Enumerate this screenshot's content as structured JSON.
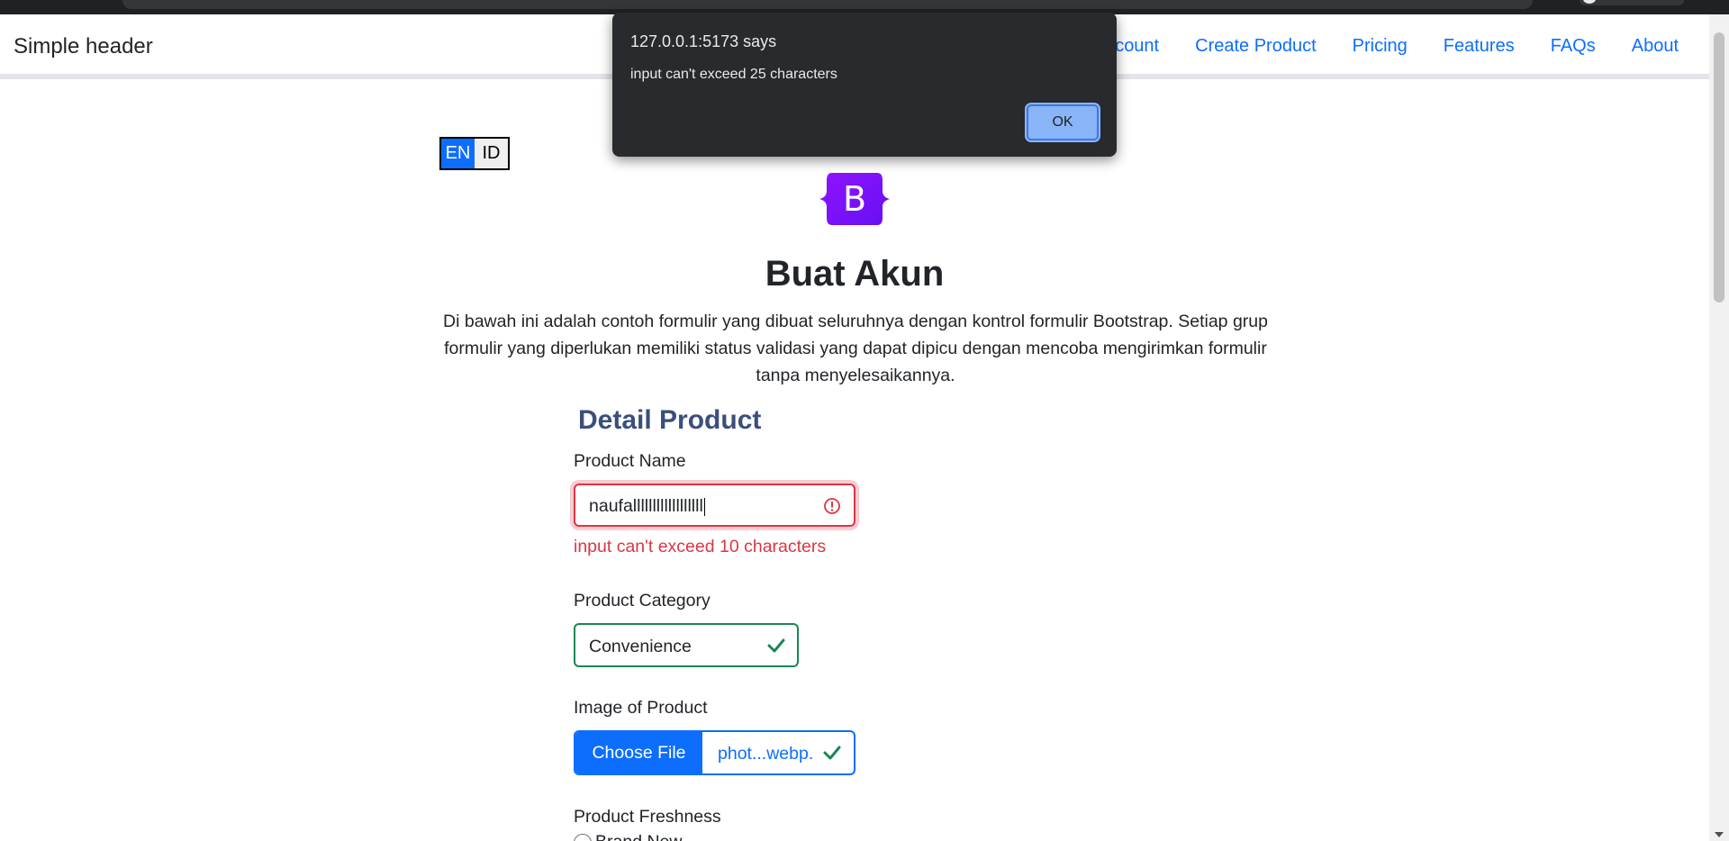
{
  "header": {
    "brand": "Simple header",
    "nav": [
      "ccount",
      "Create Product",
      "Pricing",
      "Features",
      "FAQs",
      "About"
    ]
  },
  "lang_toggle": {
    "active": "EN",
    "inactive": "ID"
  },
  "logo": {
    "letter": "B"
  },
  "page": {
    "title": "Buat Akun",
    "lead": "Di bawah ini adalah contoh formulir yang dibuat seluruhnya dengan kontrol formulir Bootstrap. Setiap grup formulir yang diperlukan memiliki status validasi yang dapat dipicu dengan mencoba mengirimkan formulir tanpa menyelesaikannya."
  },
  "form": {
    "section_title": "Detail Product",
    "product_name": {
      "label": "Product Name",
      "value": "naufallllllllllllllllll",
      "error": "input can't exceed 10 characters"
    },
    "product_category": {
      "label": "Product Category",
      "value": "Convenience"
    },
    "image": {
      "label": "Image of Product",
      "button": "Choose File",
      "filename": "phot...webp."
    },
    "freshness": {
      "label": "Product Freshness",
      "option_1": "Brand New"
    }
  },
  "dialog": {
    "title": "127.0.0.1:5173 says",
    "message": "input can't exceed 25 characters",
    "ok": "OK"
  },
  "colors": {
    "primary": "#0d6efd",
    "danger": "#dc3545",
    "success": "#198754",
    "section_title": "#3b4f7c",
    "logo_purple": "#7b14f6"
  },
  "icons": [
    "error-circle-icon",
    "checkmark-icon",
    "bootstrap-logo"
  ]
}
